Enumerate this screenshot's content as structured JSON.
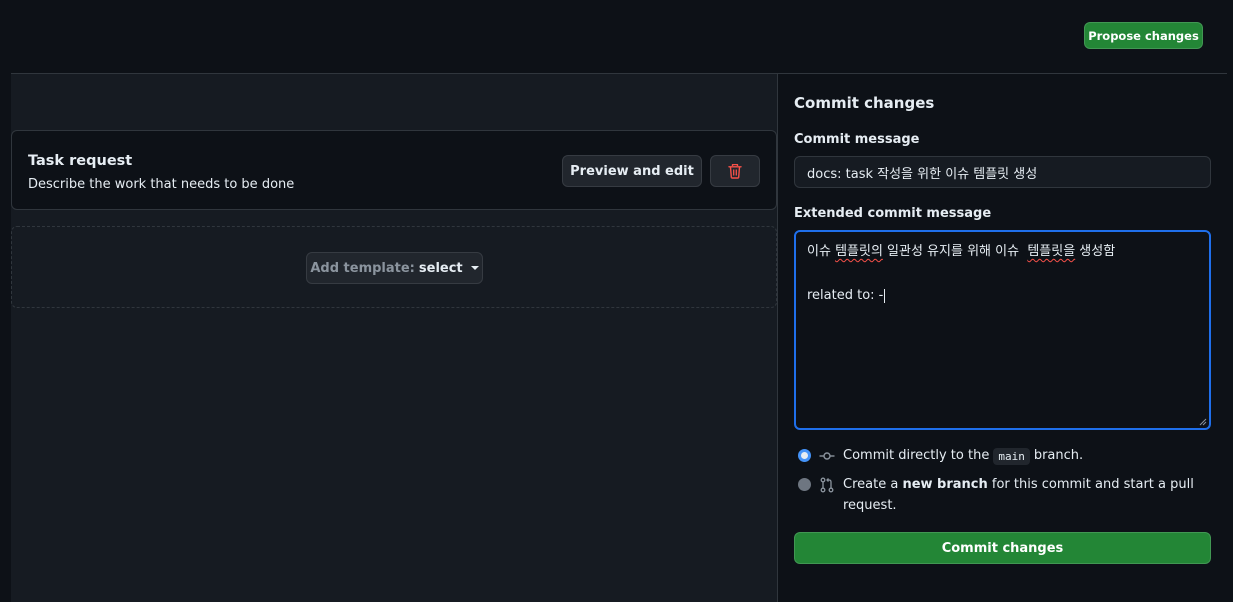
{
  "header": {
    "propose_label": "Propose changes"
  },
  "template": {
    "title": "Task request",
    "description": "Describe the work that needs to be done",
    "preview_label": "Preview and edit",
    "delete_icon": "trash-icon"
  },
  "add_template": {
    "prefix": "Add template:",
    "select_label": "select"
  },
  "commit": {
    "panel_title": "Commit changes",
    "message_label": "Commit message",
    "message_value": "docs: task 작성을 위한 이슈 템플릿 생성",
    "extended_label": "Extended commit message",
    "extended_line1_a": "이슈 ",
    "extended_line1_b": "템플릿의",
    "extended_line1_c": " 일관성 유지를 위해 이슈  ",
    "extended_line1_d": "템플릿을",
    "extended_line1_e": " 생성함",
    "extended_line2": "related to: -",
    "option_direct_pre": "Commit directly to the",
    "option_direct_branch": "main",
    "option_direct_post": "branch.",
    "option_new_pre": "Create a ",
    "option_new_bold": "new branch",
    "option_new_post": " for this commit and start a pull request.",
    "selected_option": "direct",
    "submit_label": "Commit changes"
  },
  "colors": {
    "background": "#0d1117",
    "accent_green": "#238636",
    "focus_blue": "#1f6feb",
    "danger_red": "#f85149"
  }
}
